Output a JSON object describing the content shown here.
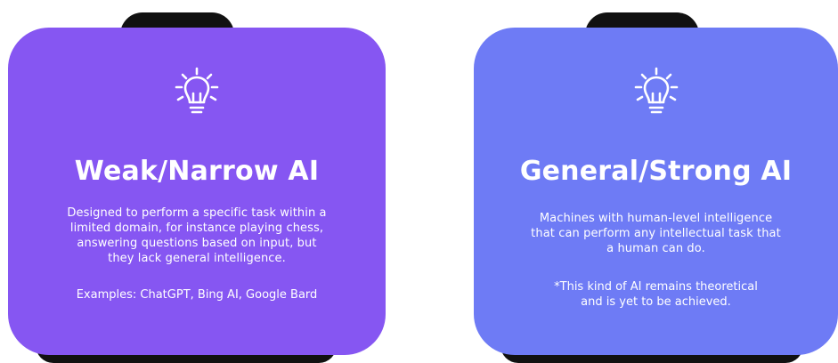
{
  "colors": {
    "weak_card": "#8656F2",
    "general_card": "#6E7BF5",
    "tab": "#111111",
    "text": "#ffffff"
  },
  "cards": [
    {
      "icon": "lightbulb-icon",
      "title": "Weak/Narrow AI",
      "description_lines": [
        "Designed to perform a specific task within a",
        "limited domain, for instance playing chess,",
        "answering questions based on input, but",
        "they lack general intelligence."
      ],
      "examples": "Examples: ChatGPT, Bing AI, Google Bard"
    },
    {
      "icon": "lightbulb-icon",
      "title": "General/Strong AI",
      "description_lines": [
        "Machines with human-level intelligence",
        "that can perform any intellectual task that",
        "a human can do."
      ],
      "note_lines": [
        "*This kind of AI remains theoretical",
        "and is yet to be achieved."
      ]
    }
  ]
}
